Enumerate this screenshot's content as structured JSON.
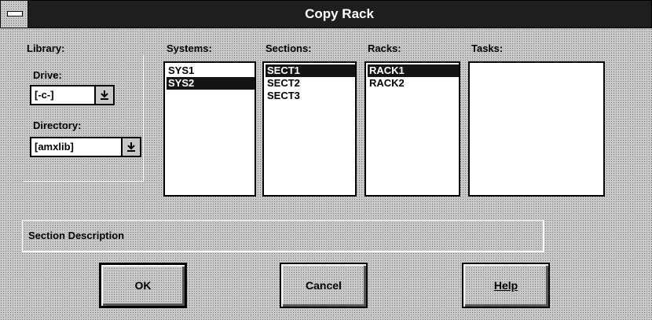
{
  "window": {
    "title": "Copy Rack"
  },
  "library": {
    "label": "Library:",
    "drive_label": "Drive:",
    "drive_value": "[-c-]",
    "directory_label": "Directory:",
    "directory_value": "[amxlib]"
  },
  "systems": {
    "label": "Systems:",
    "items": [
      "SYS1",
      "SYS2"
    ]
  },
  "sections": {
    "label": "Sections:",
    "items": [
      "SECT1",
      "SECT2",
      "SECT3"
    ]
  },
  "racks": {
    "label": "Racks:",
    "items": [
      "RACK1",
      "RACK2"
    ]
  },
  "tasks": {
    "label": "Tasks:",
    "items": []
  },
  "description": {
    "label": "Section Description"
  },
  "buttons": {
    "ok": "OK",
    "cancel": "Cancel",
    "help": "Help"
  },
  "icons": {
    "dropdown": "dropdown-arrow-icon",
    "system_menu": "system-menu-icon"
  },
  "colors": {
    "titlebar": "#1e1e1e",
    "selection": "#141414",
    "dialog": "#c8c8c8"
  }
}
